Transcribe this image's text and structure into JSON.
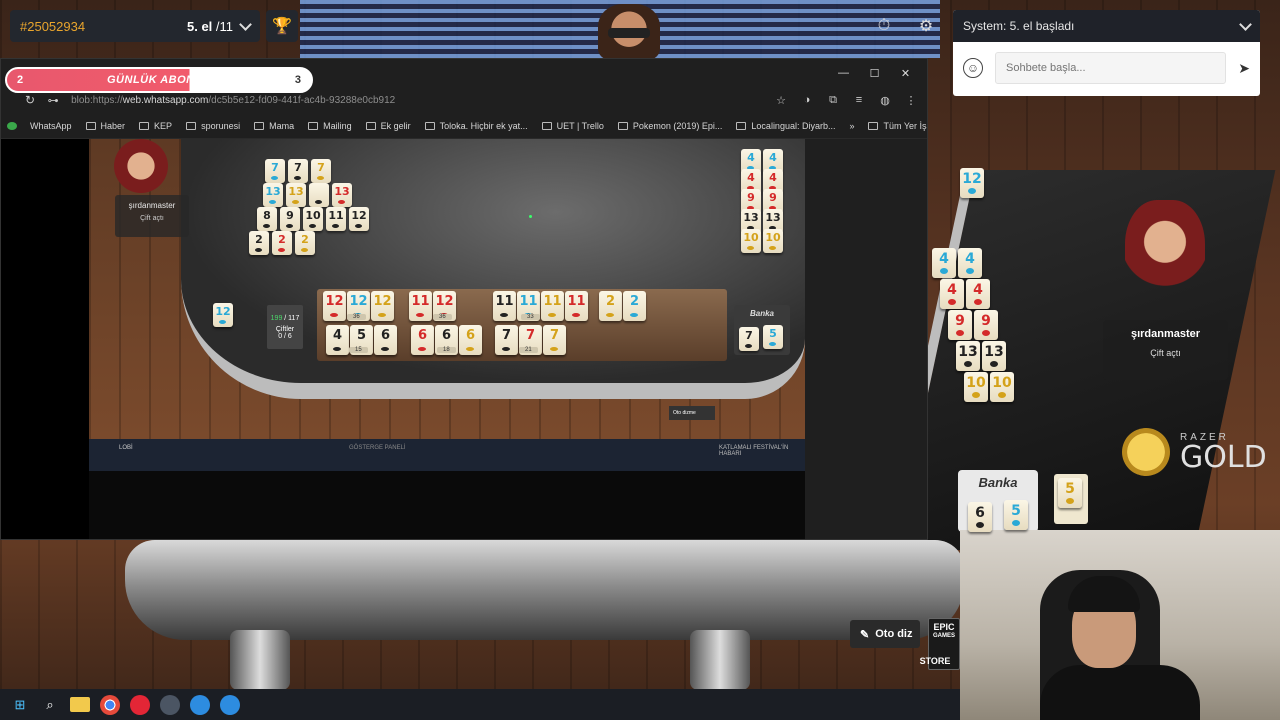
{
  "game": {
    "id": "#25052934",
    "round_current": "5. el",
    "round_total": " /11",
    "chat_system": "System: 5. el başladı",
    "chat_placeholder": "Sohbete başla...",
    "player_name": "şırdanmaster",
    "player_status": "Çift açtı",
    "bank_label": "Banka",
    "oto_label": "Oto diz",
    "razer_top": "RAZER",
    "razer_gold": "GOLD",
    "epic_line1": "EPIC",
    "epic_line2": "GAMES",
    "epic_store": "STORE",
    "right_pairs": [
      {
        "value": "4",
        "color": "blue"
      },
      {
        "value": "4",
        "color": "red"
      },
      {
        "value": "9",
        "color": "red"
      },
      {
        "value": "13",
        "color": "black"
      },
      {
        "value": "10",
        "color": "yellow"
      }
    ],
    "right_top_tile": {
      "value": "12",
      "color": "blue"
    },
    "bank_tiles": [
      {
        "value": "6",
        "color": "black"
      },
      {
        "value": "5",
        "color": "blue"
      }
    ],
    "bank_side_tile": {
      "value": "5",
      "color": "yellow"
    }
  },
  "sub_goal": {
    "current": "2",
    "label": "GÜNLÜK ABONE HEDEFİ",
    "goal": "3"
  },
  "browser": {
    "url_prefix": "blob:https://",
    "url_host": "web.whatsapp.com",
    "url_rest": "/dc5b5e12-fd09-441f-ac4b-93288e0cb912",
    "bookmarks": [
      "WhatsApp",
      "Haber",
      "KEP",
      "sporunesi",
      "Mama",
      "Mailing",
      "Ek gelir",
      "Toloka. Hiçbir ek yat...",
      "UET | Trello",
      "Pokemon (2019) Epi...",
      "Localingual: Diyarb..."
    ],
    "bookmarks_overflow": "»",
    "bookmarks_right": "Tüm Yer İşaretleri",
    "inner": {
      "player_name": "şırdanmaster",
      "player_status": "Çift açtı",
      "score_value": "199",
      "score_total": " / 117",
      "pairs_label": "Çiftler",
      "pairs_value": "0 / 6",
      "bank_label": "Banka",
      "oto_label": "Oto dizme",
      "lobi": "LOBİ",
      "panel": "GÖSTERGE PANELİ",
      "news": "KATLAMALI FESTİVAL'İN HABARI",
      "opp_rows": [
        [
          {
            "v": "7",
            "c": "blue"
          },
          {
            "v": "7",
            "c": "black"
          },
          {
            "v": "7",
            "c": "yellow"
          }
        ],
        [
          {
            "v": "13",
            "c": "blue"
          },
          {
            "v": "13",
            "c": "yellow"
          },
          {
            "v": "",
            "c": "black"
          },
          {
            "v": "13",
            "c": "red"
          }
        ],
        [
          {
            "v": "8",
            "c": "black"
          },
          {
            "v": "9",
            "c": "black"
          },
          {
            "v": "10",
            "c": "black"
          },
          {
            "v": "11",
            "c": "black"
          },
          {
            "v": "12",
            "c": "black"
          }
        ],
        [
          {
            "v": "2",
            "c": "black"
          },
          {
            "v": "2",
            "c": "red"
          },
          {
            "v": "2",
            "c": "yellow"
          }
        ]
      ],
      "right_rows": [
        [
          {
            "v": "4",
            "c": "blue"
          },
          {
            "v": "4",
            "c": "blue"
          }
        ],
        [
          {
            "v": "4",
            "c": "red"
          },
          {
            "v": "4",
            "c": "red"
          }
        ],
        [
          {
            "v": "9",
            "c": "red"
          },
          {
            "v": "9",
            "c": "red"
          }
        ],
        [
          {
            "v": "13",
            "c": "black"
          },
          {
            "v": "13",
            "c": "black"
          }
        ],
        [
          {
            "v": "10",
            "c": "yellow"
          },
          {
            "v": "10",
            "c": "yellow"
          }
        ]
      ],
      "rack_top": [
        {
          "v": "12",
          "c": "red"
        },
        {
          "v": "12",
          "c": "blue"
        },
        {
          "v": "12",
          "c": "yellow"
        },
        {
          "v": "11",
          "c": "red"
        },
        {
          "v": "12",
          "c": "red"
        },
        {
          "v": "11",
          "c": "black"
        },
        {
          "v": "11",
          "c": "blue"
        },
        {
          "v": "11",
          "c": "yellow"
        },
        {
          "v": "11",
          "c": "red"
        },
        {
          "v": "2",
          "c": "yellow"
        },
        {
          "v": "2",
          "c": "blue"
        }
      ],
      "rack_bottom": [
        {
          "v": "4",
          "c": "black"
        },
        {
          "v": "5",
          "c": "black"
        },
        {
          "v": "6",
          "c": "black"
        },
        {
          "v": "6",
          "c": "red"
        },
        {
          "v": "6",
          "c": "black"
        },
        {
          "v": "6",
          "c": "yellow"
        },
        {
          "v": "7",
          "c": "black"
        },
        {
          "v": "7",
          "c": "red"
        },
        {
          "v": "7",
          "c": "yellow"
        }
      ],
      "rack_sums": [
        "36",
        "36",
        "33",
        "15",
        "18",
        "21"
      ],
      "left_tile": {
        "v": "12",
        "c": "blue"
      },
      "bank_tiles": [
        {
          "v": "7",
          "c": "black"
        },
        {
          "v": "5",
          "c": "blue"
        }
      ]
    }
  },
  "colors": {
    "accent": "#e9a52d",
    "blue_tile": "#2aa9d6",
    "red_tile": "#d42a2a",
    "yellow_tile": "#d4a21a",
    "black_tile": "#222222",
    "sub_goal_bar": "#f15b6c"
  },
  "icons": {
    "trophy": "trophy-icon",
    "timer": "timer-icon",
    "settings": "gear-icon",
    "emoji": "smiley-icon",
    "send": "send-icon"
  }
}
